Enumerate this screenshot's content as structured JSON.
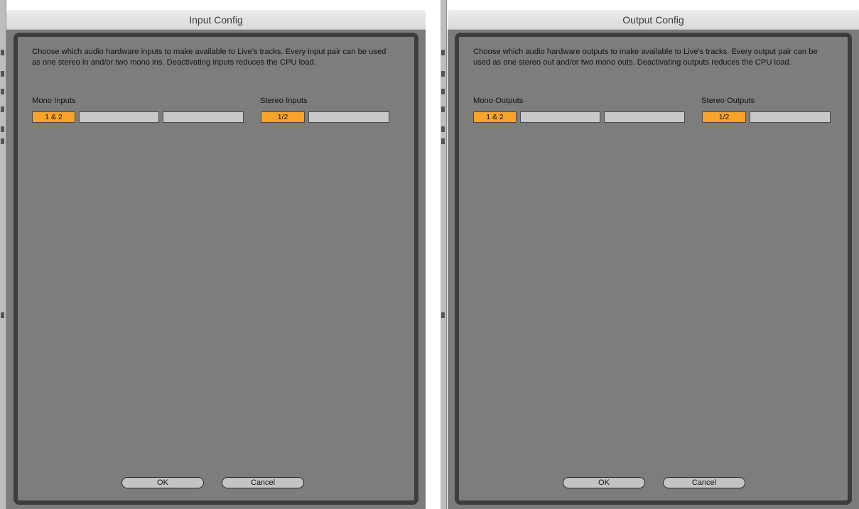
{
  "input_dialog": {
    "title": "Input Config",
    "description": "Choose which audio hardware inputs to make available to Live's tracks. Every input pair can be used as one stereo in and/or two mono ins.  Deactivating inputs reduces the CPU load.",
    "mono_label": "Mono Inputs",
    "stereo_label": "Stereo Inputs",
    "mono_slots": [
      {
        "label": "1 & 2",
        "active": true
      },
      {
        "label": "",
        "active": false
      },
      {
        "label": "",
        "active": false
      }
    ],
    "stereo_slots": [
      {
        "label": "1/2",
        "active": true
      },
      {
        "label": "",
        "active": false
      }
    ],
    "ok_label": "OK",
    "cancel_label": "Cancel"
  },
  "output_dialog": {
    "title": "Output Config",
    "description": "Choose which audio hardware outputs to make available to Live's tracks. Every output pair can be used as one stereo out and/or two mono outs.  Deactivating outputs reduces the CPU load.",
    "mono_label": "Mono Outputs",
    "stereo_label": "Stereo Outputs",
    "mono_slots": [
      {
        "label": "1 & 2",
        "active": true
      },
      {
        "label": "",
        "active": false
      },
      {
        "label": "",
        "active": false
      }
    ],
    "stereo_slots": [
      {
        "label": "1/2",
        "active": true
      },
      {
        "label": "",
        "active": false
      }
    ],
    "ok_label": "OK",
    "cancel_label": "Cancel"
  },
  "colors": {
    "active_slot": "#f8a42c",
    "inactive_slot": "#c9c9c9",
    "dialog_body": "#7c7c7c",
    "frame_border": "#3d3d3d"
  }
}
